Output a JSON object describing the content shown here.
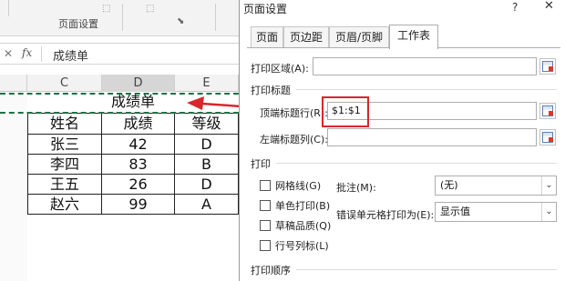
{
  "ribbon": {
    "group_label": "页面设置",
    "launcher_icon": "dialog-launcher-icon"
  },
  "formula_bar": {
    "fx_label": "fx",
    "content": "成绩单"
  },
  "columns": [
    "C",
    "D",
    "E"
  ],
  "selected_column": "D",
  "sheet": {
    "title": "成绩单",
    "headers": [
      "姓名",
      "成绩",
      "等级"
    ],
    "rows": [
      [
        "张三",
        "42",
        "D"
      ],
      [
        "李四",
        "83",
        "B"
      ],
      [
        "王五",
        "26",
        "D"
      ],
      [
        "赵六",
        "99",
        "A"
      ]
    ]
  },
  "colors": {
    "selection_dash": "#1f7145",
    "annotation_red": "#d9262c"
  },
  "dialog": {
    "title": "页面设置",
    "help": "?",
    "close": "✕",
    "tabs": [
      "页面",
      "页边距",
      "页眉/页脚",
      "工作表"
    ],
    "active_tab": "工作表",
    "print_area_label": "打印区域(A):",
    "print_area_value": "",
    "print_titles_section": "打印标题",
    "top_rows_label": "顶端标题行(R):",
    "top_rows_value": "$1:$1",
    "left_cols_label": "左端标题列(C):",
    "left_cols_value": "",
    "print_section": "打印",
    "checkboxes": [
      "网格线(G)",
      "单色打印(B)",
      "草稿品质(Q)",
      "行号列标(L)"
    ],
    "comments_label": "批注(M):",
    "comments_value": "(无)",
    "errors_label": "错误单元格打印为(E):",
    "errors_value": "显示值",
    "order_section": "打印顺序"
  }
}
